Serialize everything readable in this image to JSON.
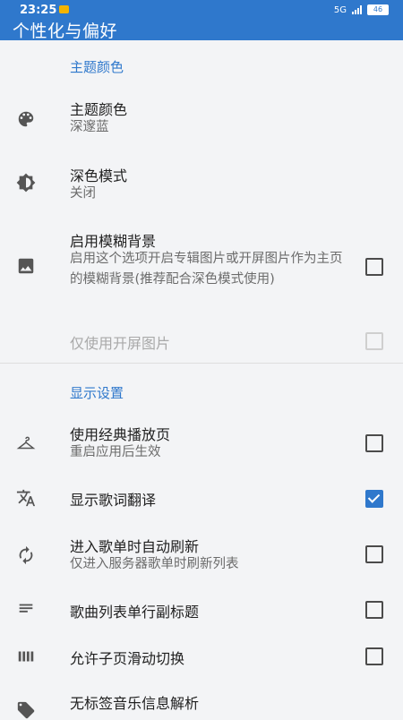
{
  "status_bar": {
    "time": "23:25",
    "signal_text": "5G",
    "battery": "46"
  },
  "app_bar": {
    "title": "个性化与偏好"
  },
  "sections": [
    {
      "header": "主题颜色",
      "items": [
        {
          "title": "主题颜色",
          "subtitle": "深邃蓝",
          "icon": "palette-icon"
        },
        {
          "title": "深色模式",
          "subtitle": "关闭",
          "icon": "brightness-icon"
        },
        {
          "title": "启用模糊背景",
          "subtitle": "启用这个选项开启专辑图片或开屏图片作为主页的模糊背景(推荐配合深色模式使用)",
          "icon": "image-icon",
          "checked": false
        },
        {
          "title": "仅使用开屏图片",
          "disabled": true,
          "checked": false
        }
      ]
    },
    {
      "header": "显示设置",
      "items": [
        {
          "title": "使用经典播放页",
          "subtitle": "重启应用后生效",
          "icon": "hanger-icon",
          "checked": false
        },
        {
          "title": "显示歌词翻译",
          "icon": "translate-icon",
          "checked": true
        },
        {
          "title": "进入歌单时自动刷新",
          "subtitle": "仅进入服务器歌单时刷新列表",
          "icon": "refresh-icon",
          "checked": false
        },
        {
          "title": "歌曲列表单行副标题",
          "icon": "short-text-icon",
          "checked": false
        },
        {
          "title": "允许子页滑动切换",
          "icon": "view-column-icon",
          "checked": false
        },
        {
          "title": "无标签音乐信息解析",
          "icon": "tag-icon"
        }
      ]
    }
  ],
  "colors": {
    "accent": "#2f78cc",
    "background": "#f3f4f6"
  }
}
